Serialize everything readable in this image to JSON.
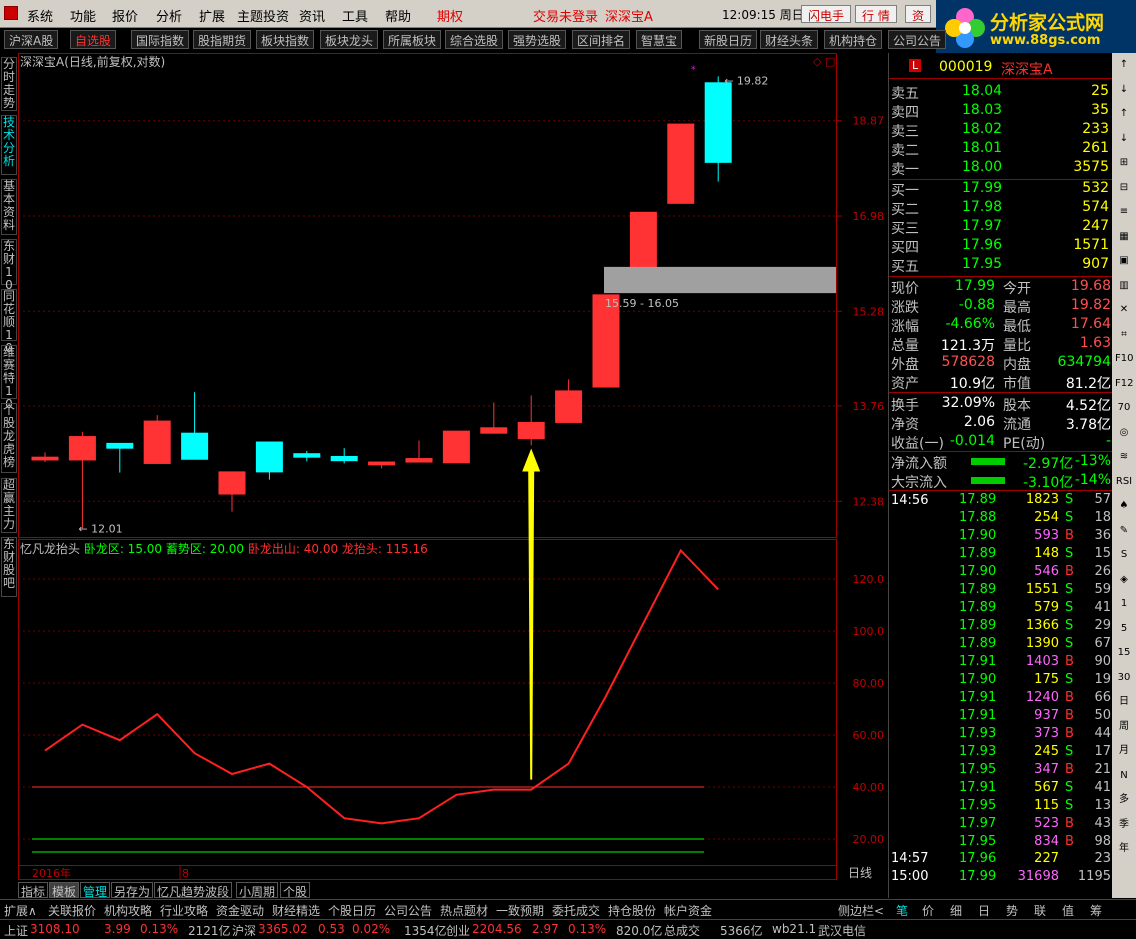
{
  "menu": {
    "items": [
      "系统",
      "功能",
      "报价",
      "分析",
      "扩展",
      "主题投资",
      "资讯",
      "工具",
      "帮助"
    ],
    "futures": "期权",
    "login": "交易未登录",
    "stock": "深深宝A",
    "time": "12:09:15 周日",
    "flash": "闪电手",
    "quote": "行 情",
    "asset": "资"
  },
  "logo": {
    "title": "分析家公式网",
    "url": "www.88gs.com"
  },
  "toolbar": [
    "沪深A股",
    "自选股",
    "国际指数",
    "股指期货",
    "板块指数",
    "板块龙头",
    "所属板块",
    "综合选股",
    "强势选股",
    "区间排名",
    "智慧宝",
    "新股日历",
    "财经头条",
    "机构持仓",
    "公司公告"
  ],
  "lefttabs": [
    "分时走势",
    "技术分析",
    "基本资料",
    "东财10",
    "同花顺10",
    "维赛特10",
    "个股龙虎榜",
    "超赢主力",
    "东财股吧"
  ],
  "chart": {
    "title": "深深宝A(日线,前复权,对数)",
    "indicator_name": "忆凡龙抬头",
    "ind_labels": [
      {
        "t": "卧龙区: 15.00",
        "c": "#00ff00"
      },
      {
        "t": "蓄势区: 20.00",
        "c": "#00ff00"
      },
      {
        "t": "卧龙出山: 40.00",
        "c": "#ff3030"
      },
      {
        "t": "龙抬头: 115.16",
        "c": "#ff3030"
      }
    ],
    "price_ticks": [
      "18.87",
      "16.98",
      "15.28",
      "13.76",
      "12.38"
    ],
    "ind_ticks": [
      "120.0",
      "100.0",
      "80.00",
      "60.00",
      "40.00",
      "20.00"
    ],
    "high_label": "19.82",
    "low_label": "12.01",
    "range_label": "15.59 - 16.05",
    "year_label": "2016年",
    "month_label": "8",
    "period_label": "日线"
  },
  "chart_data": {
    "type": "candlestick",
    "candles": [
      {
        "o": 13.0,
        "h": 13.07,
        "l": 12.93,
        "c": 12.96
      },
      {
        "o": 13.3,
        "h": 13.37,
        "l": 12.01,
        "c": 12.96
      },
      {
        "o": 13.13,
        "h": 13.2,
        "l": 12.78,
        "c": 13.2
      },
      {
        "o": 13.53,
        "h": 13.62,
        "l": 12.91,
        "c": 12.91
      },
      {
        "o": 12.97,
        "h": 13.97,
        "l": 12.97,
        "c": 13.35
      },
      {
        "o": 12.79,
        "h": 12.79,
        "l": 12.24,
        "c": 12.48
      },
      {
        "o": 12.79,
        "h": 13.22,
        "l": 12.68,
        "c": 13.22
      },
      {
        "o": 13.0,
        "h": 13.09,
        "l": 12.94,
        "c": 13.05
      },
      {
        "o": 12.95,
        "h": 13.13,
        "l": 12.91,
        "c": 13.01
      },
      {
        "o": 12.93,
        "h": 12.93,
        "l": 12.84,
        "c": 12.89
      },
      {
        "o": 12.98,
        "h": 13.24,
        "l": 12.94,
        "c": 12.93
      },
      {
        "o": 13.38,
        "h": 13.38,
        "l": 12.92,
        "c": 12.92
      },
      {
        "o": 13.43,
        "h": 13.81,
        "l": 13.35,
        "c": 13.35
      },
      {
        "o": 13.51,
        "h": 13.92,
        "l": 13.17,
        "c": 13.27
      },
      {
        "o": 13.99,
        "h": 14.17,
        "l": 13.51,
        "c": 13.51
      },
      {
        "o": 15.56,
        "h": 15.56,
        "l": 14.05,
        "c": 14.05
      },
      {
        "o": 17.05,
        "h": 17.05,
        "l": 16.03,
        "c": 16.03
      },
      {
        "o": 18.8,
        "h": 18.8,
        "l": 17.22,
        "c": 17.22
      },
      {
        "o": 18.02,
        "h": 19.82,
        "l": 17.64,
        "c": 19.68
      }
    ],
    "indicator": [
      54,
      64,
      58,
      68,
      53,
      45,
      49,
      40,
      28,
      26,
      28,
      37,
      39,
      39,
      49,
      75,
      103,
      131,
      116
    ],
    "ind_levels": [
      {
        "v": 40,
        "c": "#ff3030"
      },
      {
        "v": 20,
        "c": "#00ff00"
      },
      {
        "v": 15,
        "c": "#00ff00"
      }
    ],
    "price_range": [
      11.9,
      20.25
    ],
    "ind_range": [
      10,
      135
    ]
  },
  "quote": {
    "code": "000019",
    "name": "深深宝A",
    "asks": [
      [
        "卖五",
        "18.04",
        "25"
      ],
      [
        "卖四",
        "18.03",
        "35"
      ],
      [
        "卖三",
        "18.02",
        "233"
      ],
      [
        "卖二",
        "18.01",
        "261"
      ],
      [
        "卖一",
        "18.00",
        "3575"
      ]
    ],
    "bids": [
      [
        "买一",
        "17.99",
        "532"
      ],
      [
        "买二",
        "17.98",
        "574"
      ],
      [
        "买三",
        "17.97",
        "247"
      ],
      [
        "买四",
        "17.96",
        "1571"
      ],
      [
        "买五",
        "17.95",
        "907"
      ]
    ],
    "stats": [
      [
        "现价",
        "17.99",
        "今开",
        "19.68"
      ],
      [
        "涨跌",
        "-0.88",
        "最高",
        "19.82"
      ],
      [
        "涨幅",
        "-4.66%",
        "最低",
        "17.64"
      ],
      [
        "总量",
        "121.3万",
        "量比",
        "1.63"
      ],
      [
        "外盘",
        "578628",
        "内盘",
        "634794"
      ],
      [
        "资产",
        "10.9亿",
        "市值",
        "81.2亿"
      ],
      [
        "换手",
        "32.09%",
        "股本",
        "4.52亿"
      ],
      [
        "净资",
        "2.06",
        "流通",
        "3.78亿"
      ],
      [
        "收益(一)",
        "-0.014",
        "PE(动)",
        "-"
      ]
    ],
    "flows": [
      [
        "净流入额",
        "-2.97亿",
        "-13%"
      ],
      [
        "大宗流入",
        "-3.10亿",
        "-14%"
      ]
    ],
    "ticks_time": "14:56",
    "ticks": [
      [
        "17.89",
        "1823",
        "S",
        "57"
      ],
      [
        "17.88",
        "254",
        "S",
        "18"
      ],
      [
        "17.90",
        "593",
        "B",
        "36"
      ],
      [
        "17.89",
        "148",
        "S",
        "15"
      ],
      [
        "17.90",
        "546",
        "B",
        "26"
      ],
      [
        "17.89",
        "1551",
        "S",
        "59"
      ],
      [
        "17.89",
        "579",
        "S",
        "41"
      ],
      [
        "17.89",
        "1366",
        "S",
        "29"
      ],
      [
        "17.89",
        "1390",
        "S",
        "67"
      ],
      [
        "17.91",
        "1403",
        "B",
        "90"
      ],
      [
        "17.90",
        "175",
        "S",
        "19"
      ],
      [
        "17.91",
        "1240",
        "B",
        "66"
      ],
      [
        "17.91",
        "937",
        "B",
        "50"
      ],
      [
        "17.93",
        "373",
        "B",
        "44"
      ],
      [
        "17.93",
        "245",
        "S",
        "17"
      ],
      [
        "17.95",
        "347",
        "B",
        "21"
      ],
      [
        "17.91",
        "567",
        "S",
        "41"
      ],
      [
        "17.95",
        "115",
        "S",
        "13"
      ],
      [
        "17.97",
        "523",
        "B",
        "43"
      ],
      [
        "17.95",
        "834",
        "B",
        "98"
      ]
    ],
    "tick_1457": [
      "14:57",
      "17.96",
      "227",
      "23"
    ],
    "tick_1500": [
      "15:00",
      "17.99",
      "31698",
      "1195"
    ]
  },
  "icons": [
    "↑",
    "↓",
    "↑",
    "↓",
    "⊞",
    "⊟",
    "≡",
    "▦",
    "▣",
    "▥",
    "✕",
    "⌗",
    "F10",
    "F12",
    "70",
    "◎",
    "≋",
    "RSI",
    "♠",
    "✎",
    "S",
    "◈",
    "1",
    "5",
    "15",
    "30",
    "日",
    "周",
    "月",
    "N",
    "多",
    "季",
    "年"
  ],
  "subtabs": [
    "指标",
    "模板",
    "管理",
    "另存为",
    "忆凡趋势波段",
    "小周期",
    "个股"
  ],
  "bottomtabs": [
    "扩展∧",
    "关联报价",
    "机构攻略",
    "行业攻略",
    "资金驱动",
    "财经精选",
    "个股日历",
    "公司公告",
    "热点题材",
    "一致预期",
    "委托成交",
    "持仓股份",
    "帐户资金",
    "侧边栏<",
    "笔",
    "价",
    "细",
    "日",
    "势",
    "联",
    "值",
    "筹"
  ],
  "statusbar": {
    "sh": "上证",
    "sh_v": "3108.10",
    "sh_c": "3.99",
    "sh_p": "0.13%",
    "sh_a": "2121亿",
    "hs": "沪深",
    "hs_v": "3365.02",
    "hs_c": "0.53",
    "hs_p": "0.02%",
    "hs_a": "1354亿",
    "cy": "创业",
    "cy_v": "2204.56",
    "cy_c": "2.97",
    "cy_p": "0.13%",
    "cy_a": "820.0亿",
    "total": "总成交",
    "total_v": "5366亿",
    "ver": "wb21.1",
    "isp": "武汉电信"
  }
}
